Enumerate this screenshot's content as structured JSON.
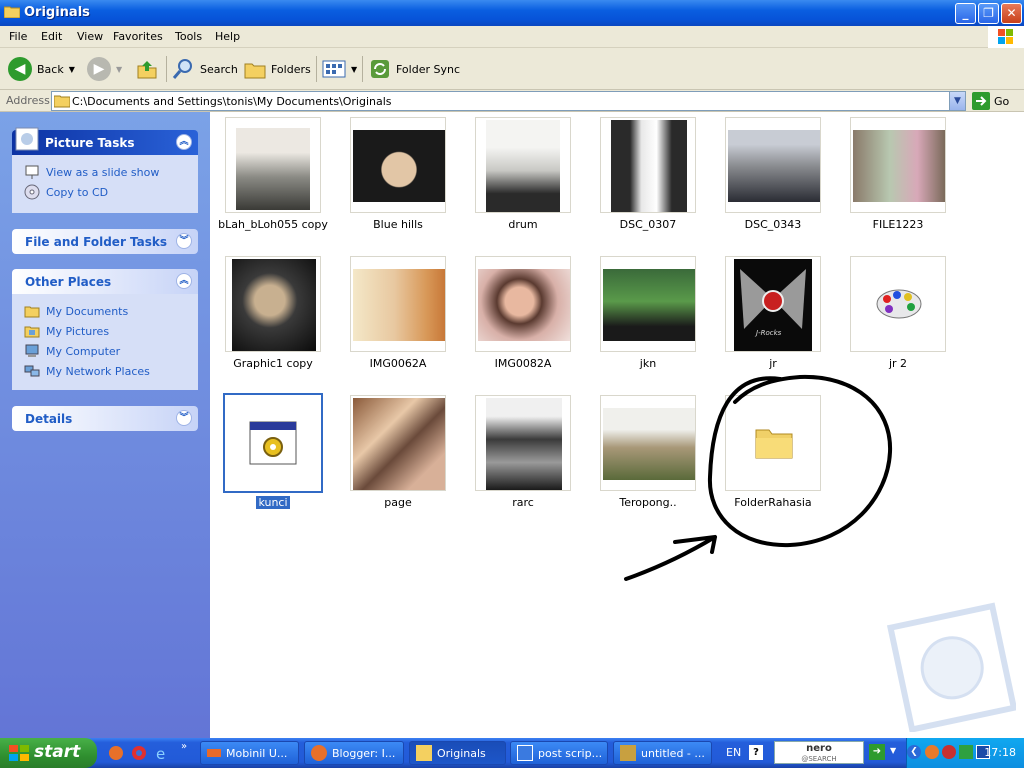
{
  "window": {
    "title": "Originals",
    "controls": [
      "minimize",
      "maximize",
      "close"
    ]
  },
  "menu": [
    "File",
    "Edit",
    "View",
    "Favorites",
    "Tools",
    "Help"
  ],
  "toolbar": {
    "back_label": "Back",
    "search_label": "Search",
    "folders_label": "Folders",
    "foldersync_label": "Folder Sync"
  },
  "address": {
    "label": "Address",
    "path": "C:\\Documents and Settings\\tonis\\My Documents\\Originals",
    "go_label": "Go"
  },
  "sidebar": {
    "picture_tasks": {
      "title": "Picture Tasks",
      "items": [
        "View as a slide show",
        "Copy to CD"
      ]
    },
    "file_tasks": {
      "title": "File and Folder Tasks"
    },
    "other_places": {
      "title": "Other Places",
      "items": [
        "My Documents",
        "My Pictures",
        "My Computer",
        "My Network Places"
      ]
    },
    "details": {
      "title": "Details"
    }
  },
  "files": [
    {
      "name": "bLah_bLoh055 copy"
    },
    {
      "name": "Blue hills"
    },
    {
      "name": "drum"
    },
    {
      "name": "DSC_0307"
    },
    {
      "name": "DSC_0343"
    },
    {
      "name": "FILE1223"
    },
    {
      "name": "Graphic1 copy"
    },
    {
      "name": "IMG0062A"
    },
    {
      "name": "IMG0082A"
    },
    {
      "name": "jkn"
    },
    {
      "name": "jr"
    },
    {
      "name": "jr 2"
    },
    {
      "name": "kunci",
      "selected": true
    },
    {
      "name": "page"
    },
    {
      "name": "rarc"
    },
    {
      "name": "Teropong.."
    },
    {
      "name": "FolderRahasia"
    }
  ],
  "taskbar": {
    "start_label": "start",
    "tasks": [
      "Mobinil U...",
      "Blogger: I...",
      "Originals",
      "post scrip...",
      "untitled - ..."
    ],
    "lang": "EN",
    "search_label": "nero",
    "search_sub": "@SEARCH",
    "clock": "17:18"
  },
  "jr_text": "J-Rocks"
}
